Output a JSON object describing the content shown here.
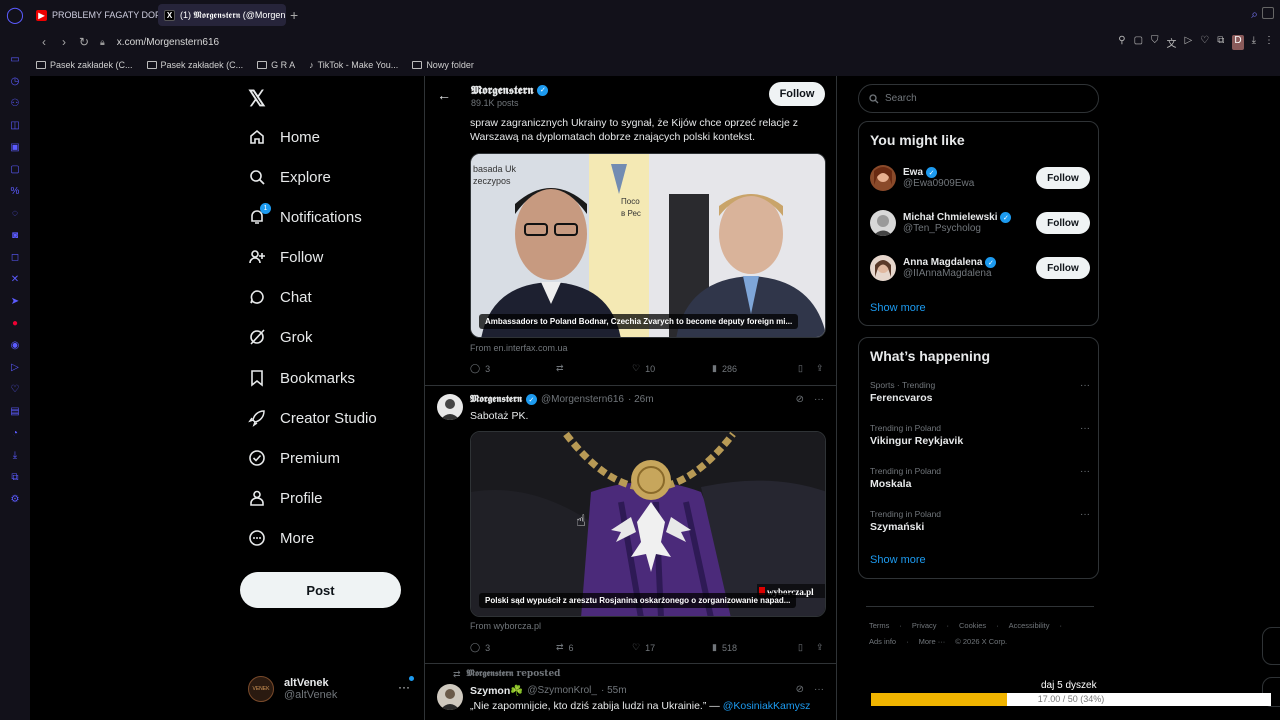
{
  "browser": {
    "tabs": [
      {
        "label": "PROBLEMY FAGATY DOPI",
        "favicon": "youtube-icon"
      },
      {
        "label": "(1) 𝕸𝖔𝖗𝖌𝖊𝖓𝖘𝖙𝖊𝖗𝖓 (@Morgen",
        "favicon": "x-icon"
      }
    ],
    "url": "x.com/Morgenstern616",
    "bookmarks": [
      "Pasek zakładek (C...",
      "Pasek zakładek (C...",
      "G R A",
      "TikTok - Make You...",
      "Nowy folder"
    ]
  },
  "nav": {
    "items": [
      {
        "label": "Home",
        "icon": "home-icon"
      },
      {
        "label": "Explore",
        "icon": "search-icon"
      },
      {
        "label": "Notifications",
        "icon": "bell-icon",
        "badge": "1"
      },
      {
        "label": "Follow",
        "icon": "person-plus-icon"
      },
      {
        "label": "Chat",
        "icon": "chat-icon"
      },
      {
        "label": "Grok",
        "icon": "grok-icon"
      },
      {
        "label": "Bookmarks",
        "icon": "bookmark-icon"
      },
      {
        "label": "Creator Studio",
        "icon": "rocket-icon"
      },
      {
        "label": "Premium",
        "icon": "premium-icon"
      },
      {
        "label": "Profile",
        "icon": "person-icon"
      },
      {
        "label": "More",
        "icon": "more-circle-icon"
      }
    ],
    "post_label": "Post",
    "account": {
      "name": "altVenek",
      "handle": "@altVenek",
      "avatar_text": "VENEK"
    }
  },
  "profile_header": {
    "name": "𝕸𝖔𝖗𝖌𝖊𝖓𝖘𝖙𝖊𝖗𝖓",
    "posts": "89.1K posts",
    "follow_label": "Follow"
  },
  "tweets": [
    {
      "text": "spraw zagranicznych Ukrainy to sygnał, że Kijów chce oprzeć relacje z Warszawą na dyplomatach dobrze znających polski kontekst.",
      "card_caption": "Ambassadors to Poland Bodnar, Czechia Zvarych to become deputy foreign mi...",
      "card_image_text": [
        "basada Uk",
        "zeczypos",
        "Посо",
        "в Рес"
      ],
      "from": "From en.interfax.com.ua",
      "replies": "3",
      "reposts": "",
      "likes": "10",
      "views": "286"
    },
    {
      "name": "𝕸𝖔𝖗𝖌𝖊𝖓𝖘𝖙𝖊𝖗𝖓",
      "handle": "@Morgenstern616",
      "time": "· 26m",
      "text": "Sabotaż PK.",
      "card_caption": "Polski sąd wypuścił z aresztu Rosjanina oskarżonego o zorganizowanie napad...",
      "card_watermark": "wyborcza.pl",
      "from": "From wyborcza.pl",
      "replies": "3",
      "reposts": "6",
      "likes": "17",
      "views": "518"
    },
    {
      "repost_label": "𝕸𝖔𝖗𝖌𝖊𝖓𝖘𝖙𝖊𝖗𝖓 reposted",
      "name": "Szymon☘️",
      "handle": "@SzymonKrol_",
      "time": "· 55m",
      "text": "„Nie zapomnijcie, kto dziś zabija ludzi na Ukrainie.” —",
      "mention": "@KosiniakKamysz"
    }
  ],
  "search": {
    "placeholder": "Search"
  },
  "you_might_like": {
    "title": "You might like",
    "users": [
      {
        "name": "Ewa",
        "handle": "@Ewa0909Ewa",
        "follow": "Follow"
      },
      {
        "name": "Michał Chmielewski",
        "handle": "@Ten_Psycholog",
        "follow": "Follow"
      },
      {
        "name": "Anna Magdalena",
        "handle": "@IIAnnaMagdalena",
        "follow": "Follow"
      }
    ],
    "show_more": "Show more"
  },
  "whats_happening": {
    "title": "What’s happening",
    "trends": [
      {
        "category": "Sports · Trending",
        "name": "Ferencvaros"
      },
      {
        "category": "Trending in Poland",
        "name": "Vikingur Reykjavik"
      },
      {
        "category": "Trending in Poland",
        "name": "Moskala"
      },
      {
        "category": "Trending in Poland",
        "name": "Szymański"
      }
    ],
    "show_more": "Show more"
  },
  "footer": {
    "row1": [
      "Terms",
      "·",
      "Privacy",
      "·",
      "Cookies",
      "·",
      "Accessibility",
      "·"
    ],
    "row2": [
      "Ads info",
      "·",
      "More ···",
      "© 2026 X Corp."
    ]
  },
  "overlay": {
    "title": "daj 5 dyszek",
    "progress_text": "17.00 / 50 (34%)",
    "progress": 0.34
  },
  "colors": {
    "accent": "#1d9bf0",
    "progress": "#f0b400",
    "opera": "#5b5bff"
  }
}
